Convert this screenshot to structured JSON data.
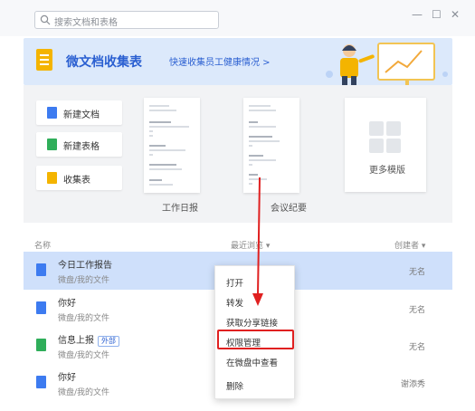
{
  "search": {
    "placeholder": "搜索文档和表格"
  },
  "window": {
    "minimize": "—",
    "maximize": "☐",
    "close": "✕"
  },
  "banner": {
    "title": "微文档收集表",
    "link": "快速收集员工健康情况 >"
  },
  "quick_create": {
    "new_doc": "新建文档",
    "new_sheet": "新建表格",
    "collect_form": "收集表"
  },
  "templates": [
    {
      "label": "工作日报"
    },
    {
      "label": "会议纪要"
    }
  ],
  "more_templates": "更多模版",
  "list": {
    "col_name": "名称",
    "col_recent": "最近浏览 ▾",
    "col_creator": "创建者 ▾",
    "rows": [
      {
        "name": "今日工作报告",
        "path": "微盘/我的文件",
        "creator": "无名",
        "tag": ""
      },
      {
        "name": "你好",
        "path": "微盘/我的文件",
        "creator": "无名",
        "tag": ""
      },
      {
        "name": "信息上报",
        "path": "微盘/我的文件",
        "creator": "无名",
        "tag": "外部"
      },
      {
        "name": "你好",
        "path": "微盘/我的文件",
        "creator": "谢添秀",
        "tag": ""
      }
    ]
  },
  "context_menu": {
    "open": "打开",
    "forward": "转发",
    "share_link": "获取分享链接",
    "permissions": "权限管理",
    "view_in_drive": "在微盘中查看",
    "delete": "删除"
  },
  "colors": {
    "doc_blue": "#3d7bf0",
    "sheet_green": "#2fae5a",
    "form_yellow": "#f4b400",
    "accent": "#2a5fd1",
    "highlight_red": "#e02020"
  }
}
